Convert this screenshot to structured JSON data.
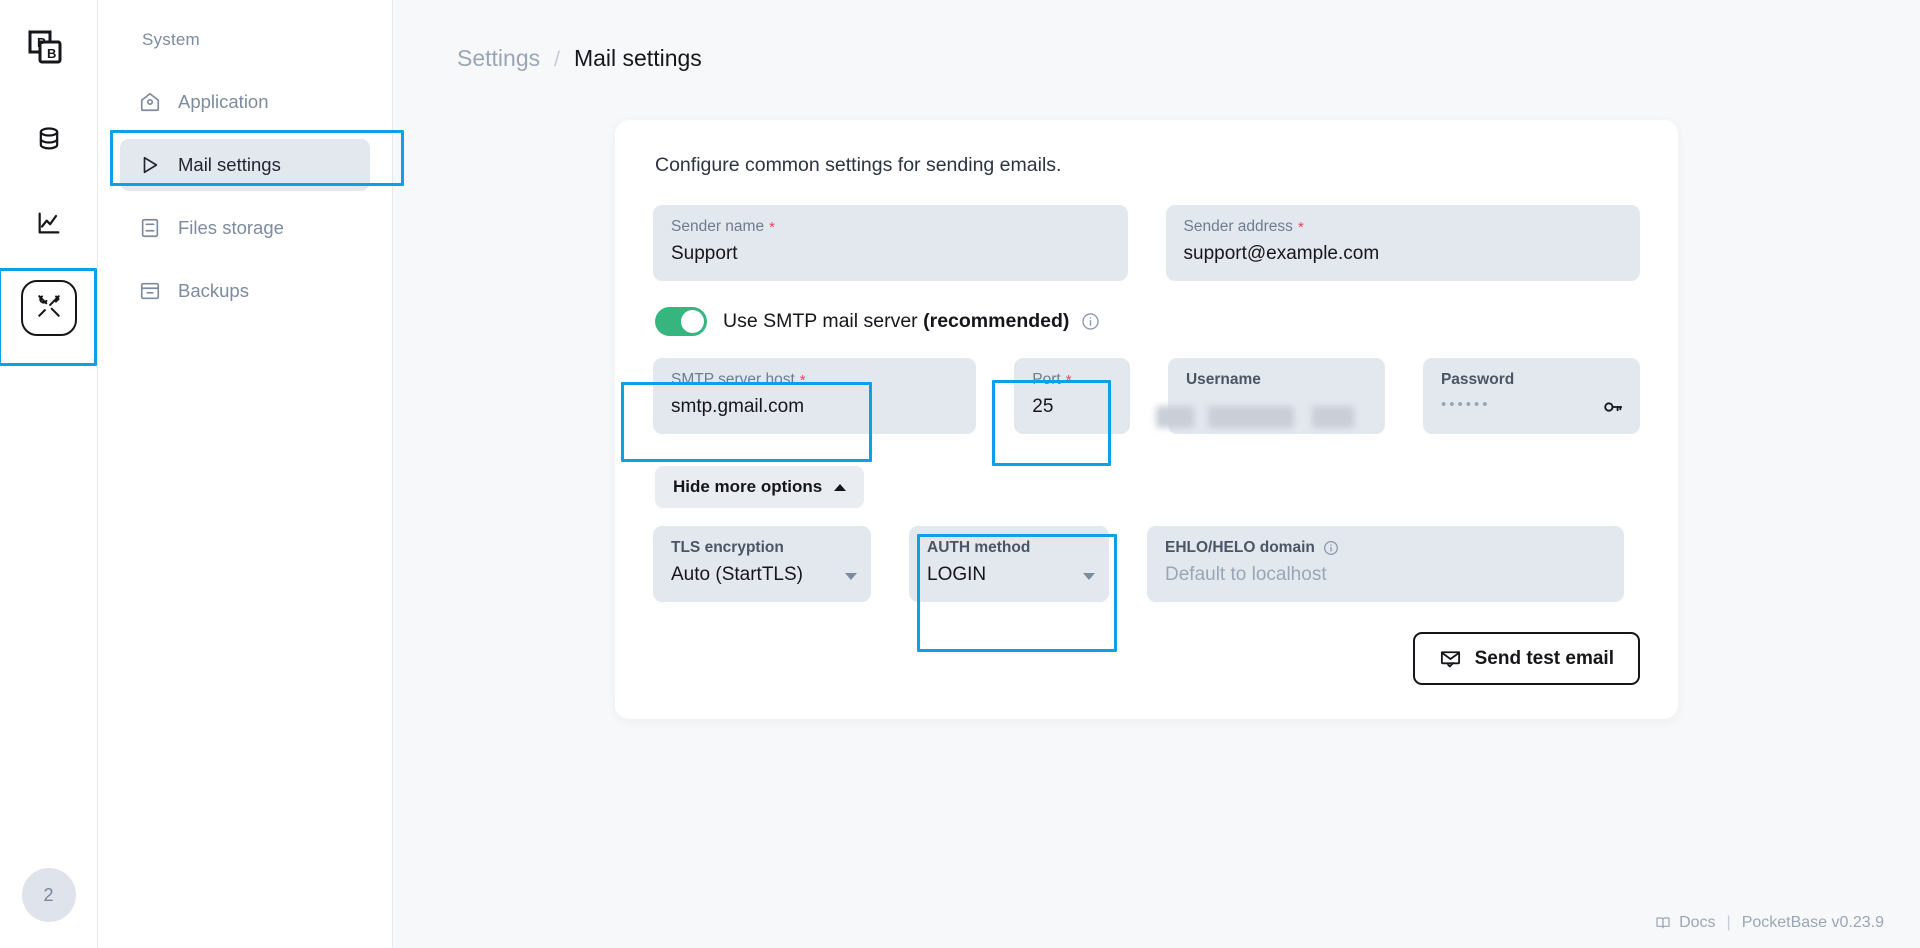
{
  "app": {
    "product": "PocketBase",
    "logo_letters": [
      "P",
      "B"
    ]
  },
  "rail": {
    "items": [
      {
        "name": "logo",
        "icon": "pocketbase-logo-icon"
      },
      {
        "name": "collections",
        "icon": "database-icon"
      },
      {
        "name": "logs",
        "icon": "chart-line-icon"
      },
      {
        "name": "settings",
        "icon": "tools-icon",
        "active": true
      }
    ],
    "avatar_label": "2"
  },
  "sidebar": {
    "title": "System",
    "items": [
      {
        "label": "Application",
        "icon": "home-gear-icon",
        "active": false
      },
      {
        "label": "Mail settings",
        "icon": "play-triangle-icon",
        "active": true
      },
      {
        "label": "Files storage",
        "icon": "archive-icon",
        "active": false
      },
      {
        "label": "Backups",
        "icon": "box-icon",
        "active": false
      }
    ]
  },
  "breadcrumb": {
    "parent": "Settings",
    "separator": "/",
    "current": "Mail settings"
  },
  "card": {
    "intro": "Configure common settings for sending emails.",
    "sender_name": {
      "label": "Sender name",
      "required": "*",
      "value": "Support"
    },
    "sender_address": {
      "label": "Sender address",
      "required": "*",
      "value": "support@example.com"
    },
    "smtp_toggle": {
      "label_prefix": "Use SMTP mail server ",
      "label_bold": "(recommended)",
      "enabled": true,
      "info_icon": "info-circle-icon"
    },
    "smtp_host": {
      "label": "SMTP server host",
      "required": "*",
      "value": "smtp.gmail.com"
    },
    "port": {
      "label": "Port",
      "required": "*",
      "value": "25"
    },
    "username": {
      "label": "Username",
      "value": "",
      "redacted": true
    },
    "password": {
      "label": "Password",
      "value": "••••••",
      "icon": "key-icon"
    },
    "hide_more_options": {
      "label": "Hide more options",
      "icon": "chevron-up-icon"
    },
    "tls_encryption": {
      "label": "TLS encryption",
      "value": "Auto (StartTLS)",
      "icon": "chevron-down-icon"
    },
    "auth_method": {
      "label": "AUTH method",
      "value": "LOGIN",
      "icon": "chevron-down-icon"
    },
    "ehlo_domain": {
      "label": "EHLO/HELO domain",
      "placeholder": "Default to localhost",
      "info_icon": "info-circle-icon"
    },
    "send_test": {
      "label": "Send test email",
      "icon": "mail-check-icon"
    }
  },
  "footer": {
    "docs": "Docs",
    "divider": "|",
    "version": "PocketBase v0.23.9",
    "docs_icon": "book-icon"
  },
  "highlights": {
    "color": "#0e9fe8"
  }
}
